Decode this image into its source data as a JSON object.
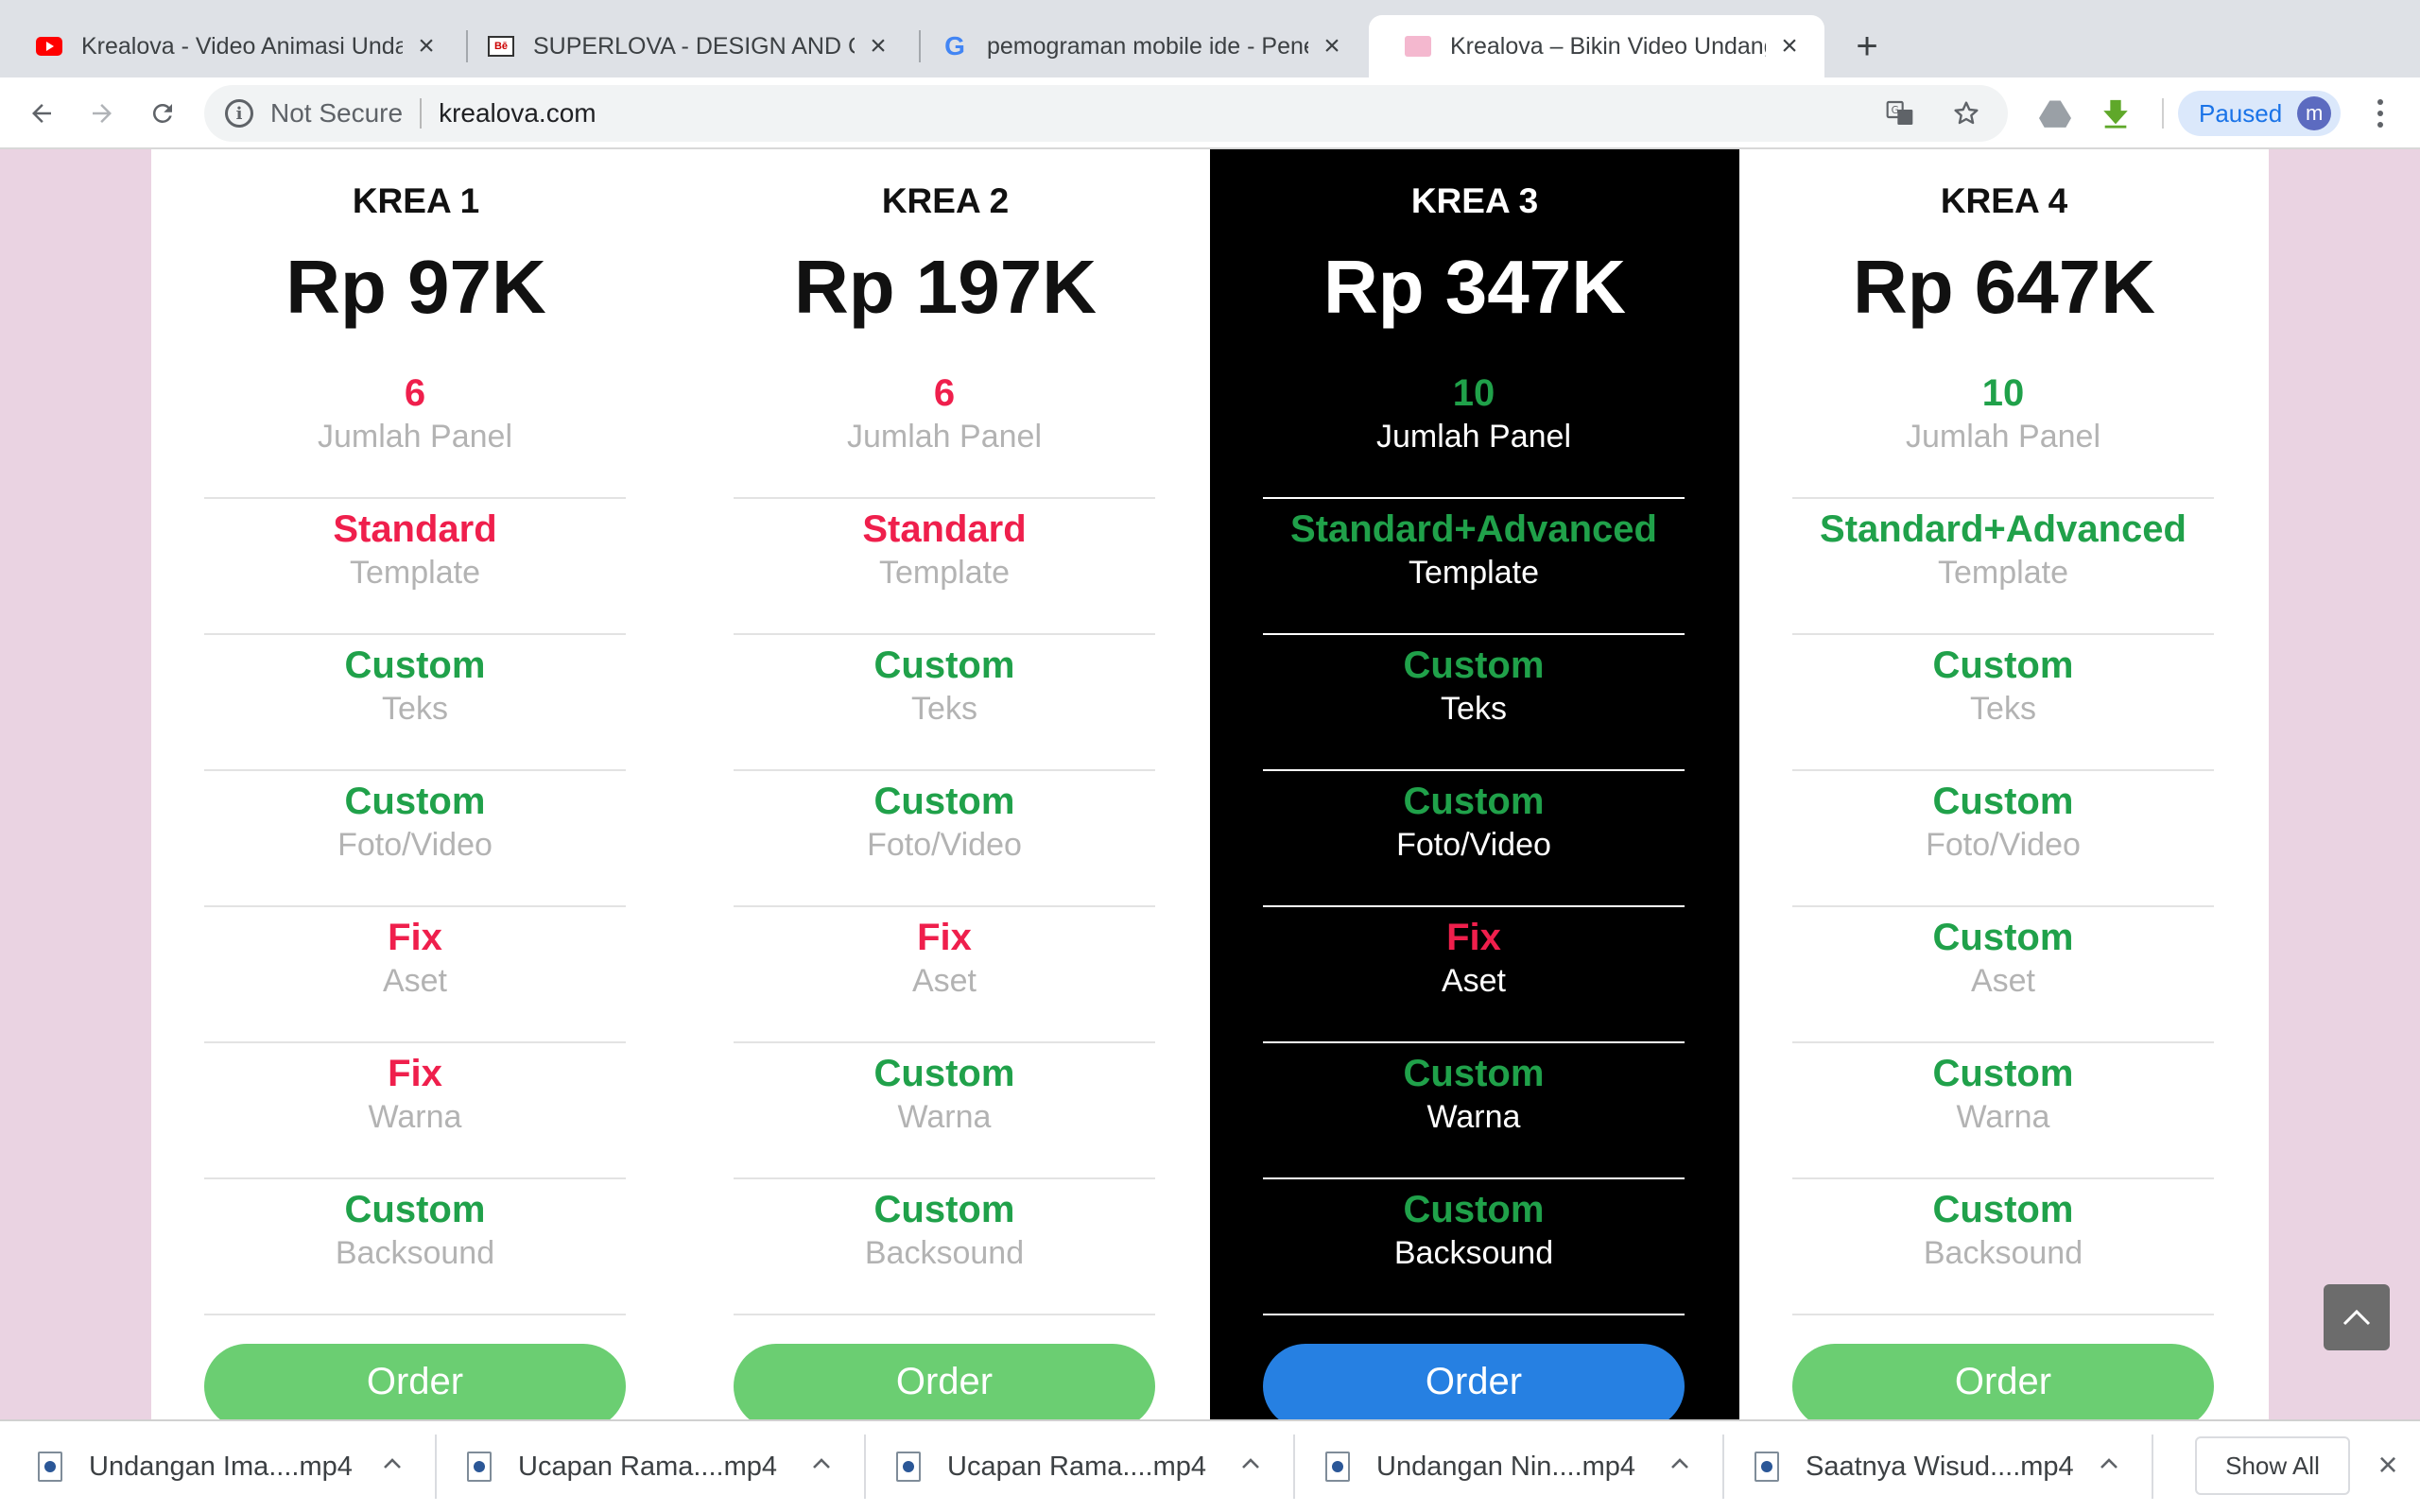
{
  "browser": {
    "tabs": [
      {
        "title": "Krealova - Video Animasi Unda",
        "icon": "youtube-icon"
      },
      {
        "title": "SUPERLOVA - DESIGN AND CR",
        "icon": "behance-icon"
      },
      {
        "title": "pemograman mobile ide - Pene",
        "icon": "google-icon"
      },
      {
        "title": "Krealova – Bikin Video Undang",
        "icon": "krealova-icon",
        "active": true
      }
    ],
    "omnibox": {
      "security_label": "Not Secure",
      "url": "krealova.com"
    },
    "profile": {
      "status": "Paused",
      "initial": "m",
      "avatar_color": "#5c6bc0"
    }
  },
  "pricing": {
    "plans": [
      {
        "name": "KREA 1",
        "price": "Rp 97K",
        "button": "Order",
        "features": [
          {
            "value": "6",
            "label": "Jumlah Panel",
            "tone": "red"
          },
          {
            "value": "Standard",
            "label": "Template",
            "tone": "red"
          },
          {
            "value": "Custom",
            "label": "Teks",
            "tone": "green"
          },
          {
            "value": "Custom",
            "label": "Foto/Video",
            "tone": "green"
          },
          {
            "value": "Fix",
            "label": "Aset",
            "tone": "red"
          },
          {
            "value": "Fix",
            "label": "Warna",
            "tone": "red"
          },
          {
            "value": "Custom",
            "label": "Backsound",
            "tone": "green"
          }
        ]
      },
      {
        "name": "KREA 2",
        "price": "Rp 197K",
        "button": "Order",
        "features": [
          {
            "value": "6",
            "label": "Jumlah Panel",
            "tone": "red"
          },
          {
            "value": "Standard",
            "label": "Template",
            "tone": "red"
          },
          {
            "value": "Custom",
            "label": "Teks",
            "tone": "green"
          },
          {
            "value": "Custom",
            "label": "Foto/Video",
            "tone": "green"
          },
          {
            "value": "Fix",
            "label": "Aset",
            "tone": "red"
          },
          {
            "value": "Custom",
            "label": "Warna",
            "tone": "green"
          },
          {
            "value": "Custom",
            "label": "Backsound",
            "tone": "green"
          }
        ]
      },
      {
        "name": "KREA 3",
        "price": "Rp 347K",
        "button": "Order",
        "featured": true,
        "features": [
          {
            "value": "10",
            "label": "Jumlah Panel",
            "tone": "green"
          },
          {
            "value": "Standard+Advanced",
            "label": "Template",
            "tone": "green"
          },
          {
            "value": "Custom",
            "label": "Teks",
            "tone": "green"
          },
          {
            "value": "Custom",
            "label": "Foto/Video",
            "tone": "green"
          },
          {
            "value": "Fix",
            "label": "Aset",
            "tone": "red"
          },
          {
            "value": "Custom",
            "label": "Warna",
            "tone": "green"
          },
          {
            "value": "Custom",
            "label": "Backsound",
            "tone": "green"
          }
        ]
      },
      {
        "name": "KREA 4",
        "price": "Rp 647K",
        "button": "Order",
        "features": [
          {
            "value": "10",
            "label": "Jumlah Panel",
            "tone": "green"
          },
          {
            "value": "Standard+Advanced",
            "label": "Template",
            "tone": "green"
          },
          {
            "value": "Custom",
            "label": "Teks",
            "tone": "green"
          },
          {
            "value": "Custom",
            "label": "Foto/Video",
            "tone": "green"
          },
          {
            "value": "Custom",
            "label": "Aset",
            "tone": "green"
          },
          {
            "value": "Custom",
            "label": "Warna",
            "tone": "green"
          },
          {
            "value": "Custom",
            "label": "Backsound",
            "tone": "green"
          }
        ]
      }
    ],
    "colors": {
      "red": "#ef1f4c",
      "green": "#20a14a",
      "order": "#6bce72",
      "order_featured": "#2680e2",
      "featured_bg": "#000000",
      "page_bg": "#ead3e2"
    }
  },
  "downloads": {
    "items": [
      {
        "name": "Undangan Ima....mp4"
      },
      {
        "name": "Ucapan Rama....mp4"
      },
      {
        "name": "Ucapan Rama....mp4"
      },
      {
        "name": "Undangan Nin....mp4"
      },
      {
        "name": "Saatnya Wisud....mp4"
      }
    ],
    "show_all": "Show All"
  }
}
